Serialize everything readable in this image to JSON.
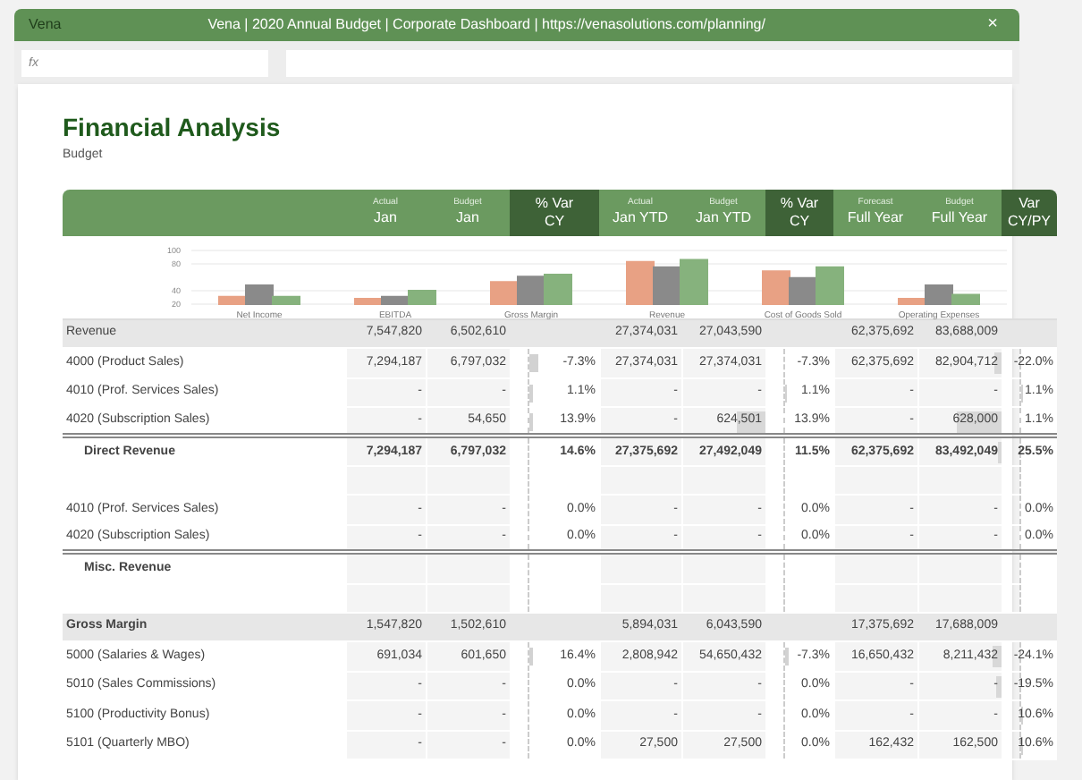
{
  "window": {
    "app": "Vena",
    "title": "Vena | 2020 Annual Budget | Corporate Dashboard | https://venasolutions.com/planning/",
    "close": "×"
  },
  "formula_bar": {
    "name_box_placeholder": "fx"
  },
  "page": {
    "title": "Financial Analysis",
    "subtitle": "Budget"
  },
  "columns": [
    {
      "kind": "value",
      "line1": "Actual",
      "line2": "Jan"
    },
    {
      "kind": "value",
      "line1": "Budget",
      "line2": "Jan"
    },
    {
      "kind": "var",
      "line1": "% Var",
      "line2": "CY"
    },
    {
      "kind": "value",
      "line1": "Actual",
      "line2": "Jan YTD"
    },
    {
      "kind": "value",
      "line1": "Budget",
      "line2": "Jan YTD"
    },
    {
      "kind": "var",
      "line1": "% Var",
      "line2": "CY"
    },
    {
      "kind": "value",
      "line1": "Forecast",
      "line2": "Full Year"
    },
    {
      "kind": "value",
      "line1": "Budget",
      "line2": "Full Year"
    },
    {
      "kind": "var",
      "line1": "Var",
      "line2": "CY/PY"
    }
  ],
  "chart_data": {
    "type": "bar",
    "categories": [
      "Net Income",
      "EBITDA",
      "Gross Margin",
      "Revenue",
      "Cost of Goods Sold",
      "Operating Expenses"
    ],
    "ylim": [
      20,
      100
    ],
    "yticks": [
      20,
      40,
      80,
      100
    ],
    "series": [
      {
        "color": "#e8a184",
        "values": [
          31,
          28,
          53,
          83,
          69,
          28
        ]
      },
      {
        "color": "#8a8a8a",
        "values": [
          48,
          31,
          61,
          75,
          59,
          48
        ]
      },
      {
        "color": "#86b27d",
        "values": [
          31,
          40,
          64,
          86,
          75,
          34
        ]
      }
    ]
  },
  "rows": [
    {
      "kind": "section",
      "label": "Revenue",
      "cells": [
        "7,547,820",
        "6,502,610",
        null,
        "27,374,031",
        "27,043,590",
        null,
        "62,375,692",
        "83,688,009",
        null
      ]
    },
    {
      "kind": "line",
      "label": "4000 (Product Sales)",
      "cells": [
        "7,294,187",
        "6,797,032",
        {
          "text": "-7.3%",
          "level": 0.14
        },
        "27,374,031",
        "27,374,031",
        "-7.3%",
        "62,375,692",
        {
          "text": "82,904,712",
          "level": 0.08
        },
        "-22.0%"
      ]
    },
    {
      "kind": "line",
      "label": "4010 (Prof. Services Sales)",
      "cells": [
        "-",
        "-",
        {
          "text": "1.1%",
          "level": 0.04
        },
        "-",
        "-",
        {
          "text": "1.1%",
          "level": 0.05
        },
        "-",
        "-",
        {
          "text": "1.1%",
          "level": 0.07
        }
      ]
    },
    {
      "kind": "line",
      "label": "4020 (Subscription Sales)",
      "rule_below": true,
      "cells": [
        "-",
        "54,650",
        {
          "text": "13.9%",
          "level": 0.06
        },
        "-",
        {
          "text": "624,501",
          "level": 0.35
        },
        "13.9%",
        "-",
        {
          "text": "628,000",
          "level": 0.55
        },
        "1.1%"
      ]
    },
    {
      "kind": "subtotal",
      "label": "Direct Revenue",
      "cells": [
        "7,294,187",
        "6,797,032",
        "14.6%",
        "27,375,692",
        "27,492,049",
        "11.5%",
        "62,375,692",
        {
          "text": "83,492,049",
          "level": 0.04
        },
        "25.5%"
      ]
    },
    {
      "kind": "blank"
    },
    {
      "kind": "line",
      "label": "4010 (Prof. Services Sales)",
      "cells": [
        "-",
        "-",
        "0.0%",
        "-",
        "-",
        "0.0%",
        "-",
        "-",
        "0.0%"
      ]
    },
    {
      "kind": "line",
      "label": "4020 (Subscription Sales)",
      "rule_below": true,
      "cells": [
        "-",
        "-",
        "0.0%",
        "-",
        "-",
        "0.0%",
        "-",
        "-",
        "0.0%"
      ]
    },
    {
      "kind": "subtotal",
      "label": "Misc. Revenue",
      "cells": [
        null,
        null,
        null,
        null,
        null,
        null,
        null,
        null,
        null
      ]
    },
    {
      "kind": "blank"
    },
    {
      "kind": "section",
      "label": "Gross Margin",
      "cells": [
        "1,547,820",
        "1,502,610",
        null,
        "5,894,031",
        "6,043,590",
        null,
        "17,375,692",
        "17,688,009",
        null
      ]
    },
    {
      "kind": "line",
      "label": "5000 (Salaries & Wages)",
      "cells": [
        "691,034",
        "601,650",
        {
          "text": "16.4%",
          "level": 0.06
        },
        "2,808,942",
        "54,650,432",
        {
          "text": "-7.3%",
          "level": 0.08
        },
        "16,650,432",
        {
          "text": "8,211,432",
          "level": 0.1
        },
        "-24.1%"
      ]
    },
    {
      "kind": "line",
      "label": "5010 (Sales Commissions)",
      "cells": [
        "-",
        "-",
        "0.0%",
        "-",
        "-",
        "0.0%",
        "-",
        {
          "text": "-",
          "level": 0.06
        },
        "-19.5%"
      ]
    },
    {
      "kind": "line",
      "label": "5100 (Productivity Bonus)",
      "cells": [
        "-",
        "-",
        "0.0%",
        "-",
        "-",
        "0.0%",
        "-",
        "-",
        {
          "text": "10.6%",
          "level": 0.07
        }
      ]
    },
    {
      "kind": "line",
      "label": "5101 (Quarterly MBO)",
      "cells": [
        "-",
        "-",
        "0.0%",
        "27,500",
        "27,500",
        "0.0%",
        "162,432",
        "162,500",
        {
          "text": "10.6%",
          "level": 0.07
        }
      ]
    }
  ]
}
